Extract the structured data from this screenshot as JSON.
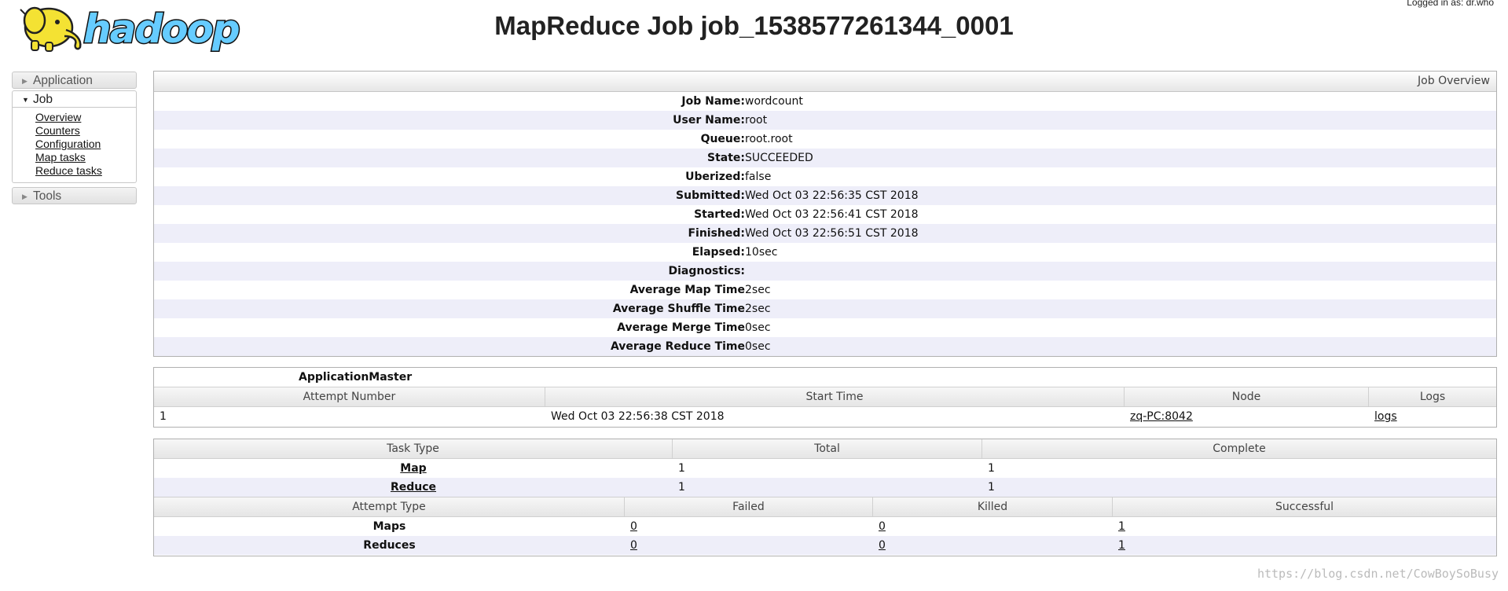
{
  "header": {
    "logo_text": "hadoop",
    "title": "MapReduce Job job_1538577261344_0001",
    "logged_in": "Logged in as: dr.who"
  },
  "sidebar": {
    "sections": [
      {
        "label": "Application",
        "expanded": false
      },
      {
        "label": "Job",
        "expanded": true
      },
      {
        "label": "Tools",
        "expanded": false
      }
    ],
    "job_links": [
      "Overview",
      "Counters",
      "Configuration",
      "Map tasks",
      "Reduce tasks"
    ]
  },
  "job_overview": {
    "title": "Job Overview",
    "rows": [
      {
        "key": "Job Name:",
        "value": "wordcount"
      },
      {
        "key": "User Name:",
        "value": "root"
      },
      {
        "key": "Queue:",
        "value": "root.root"
      },
      {
        "key": "State:",
        "value": "SUCCEEDED"
      },
      {
        "key": "Uberized:",
        "value": "false"
      },
      {
        "key": "Submitted:",
        "value": "Wed Oct 03 22:56:35 CST 2018"
      },
      {
        "key": "Started:",
        "value": "Wed Oct 03 22:56:41 CST 2018"
      },
      {
        "key": "Finished:",
        "value": "Wed Oct 03 22:56:51 CST 2018"
      },
      {
        "key": "Elapsed:",
        "value": "10sec"
      },
      {
        "key": "Diagnostics:",
        "value": ""
      },
      {
        "key": "Average Map Time",
        "value": "2sec"
      },
      {
        "key": "Average Shuffle Time",
        "value": "2sec"
      },
      {
        "key": "Average Merge Time",
        "value": "0sec"
      },
      {
        "key": "Average Reduce Time",
        "value": "0sec"
      }
    ]
  },
  "application_master": {
    "title": "ApplicationMaster",
    "headers": [
      "Attempt Number",
      "Start Time",
      "Node",
      "Logs"
    ],
    "row": {
      "attempt": "1",
      "start_time": "Wed Oct 03 22:56:38 CST 2018",
      "node": "zq-PC:8042",
      "logs": "logs"
    }
  },
  "tasks": {
    "headers": [
      "Task Type",
      "Total",
      "Complete"
    ],
    "rows": [
      {
        "type": "Map",
        "total": "1",
        "complete": "1"
      },
      {
        "type": "Reduce",
        "total": "1",
        "complete": "1"
      }
    ],
    "attempt_headers": [
      "Attempt Type",
      "Failed",
      "Killed",
      "Successful"
    ],
    "attempt_rows": [
      {
        "type": "Maps",
        "failed": "0",
        "killed": "0",
        "successful": "1"
      },
      {
        "type": "Reduces",
        "failed": "0",
        "killed": "0",
        "successful": "1"
      }
    ]
  },
  "watermark": "https://blog.csdn.net/CowBoySoBusy",
  "colors": {
    "logo_yellow": "#f4e233",
    "logo_blue": "#66ccff",
    "row_stripe": "#eeeef9",
    "border": "#b0b0b0"
  }
}
